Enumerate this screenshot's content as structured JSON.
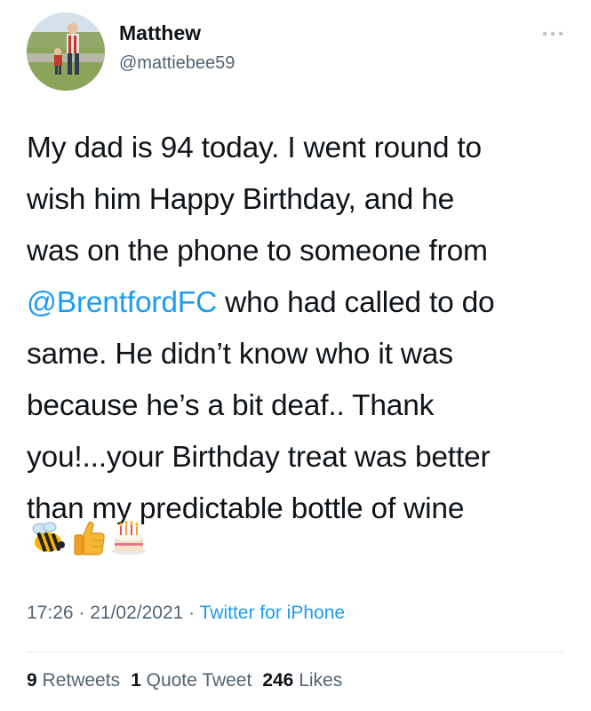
{
  "author": {
    "display_name": "Matthew",
    "handle": "@mattiebee59"
  },
  "tweet": {
    "lines": [
      "My dad is 94 today. I went round to",
      "wish him Happy Birthday, and he",
      "was on the phone to someone from"
    ],
    "mention": "@BrentfordFC",
    "line4_rest": " who had called to do",
    "lines_after": [
      "same. He didn’t know who it was",
      "because he’s a bit deaf..  Thank",
      "you!...your Birthday treat was better",
      "than my predictable bottle of wine"
    ],
    "emojis": [
      "bee-emoji",
      "thumbs-up-emoji",
      "birthday-cake-emoji"
    ]
  },
  "meta": {
    "time": "17:26",
    "sep1": " · ",
    "date": "21/02/2021",
    "sep2": " · ",
    "source": "Twitter for iPhone"
  },
  "stats": {
    "retweets_count": "9",
    "retweets_label": "Retweets",
    "quotes_count": "1",
    "quotes_label": "Quote Tweet",
    "likes_count": "246",
    "likes_label": "Likes"
  },
  "colors": {
    "link": "#1d9bf0",
    "secondary_text": "#536471",
    "primary_text": "#0f1419"
  }
}
